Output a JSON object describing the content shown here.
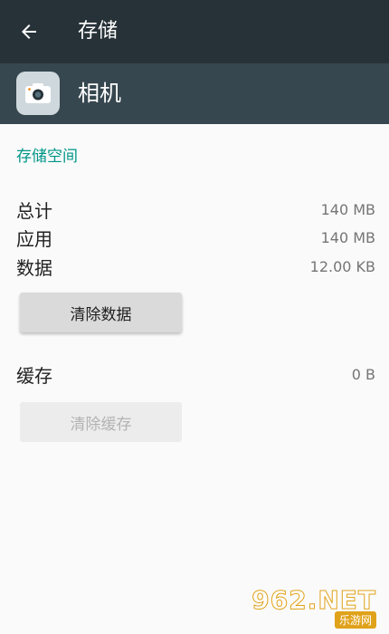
{
  "toolbar": {
    "title": "存储",
    "back_icon": "arrow-back-icon"
  },
  "app": {
    "name": "相机",
    "icon": "camera-icon"
  },
  "storage": {
    "section_title": "存储空间",
    "rows": [
      {
        "label": "总计",
        "value": "140 MB"
      },
      {
        "label": "应用",
        "value": "140 MB"
      },
      {
        "label": "数据",
        "value": "12.00 KB"
      }
    ],
    "clear_data_label": "清除数据"
  },
  "cache": {
    "label": "缓存",
    "value": "0 B",
    "clear_cache_label": "清除缓存",
    "clear_cache_enabled": false
  },
  "watermark": {
    "text": "962.NET",
    "sub": "乐游网"
  },
  "colors": {
    "toolbar": "#263238",
    "app_header": "#37474f",
    "accent": "#009688"
  }
}
